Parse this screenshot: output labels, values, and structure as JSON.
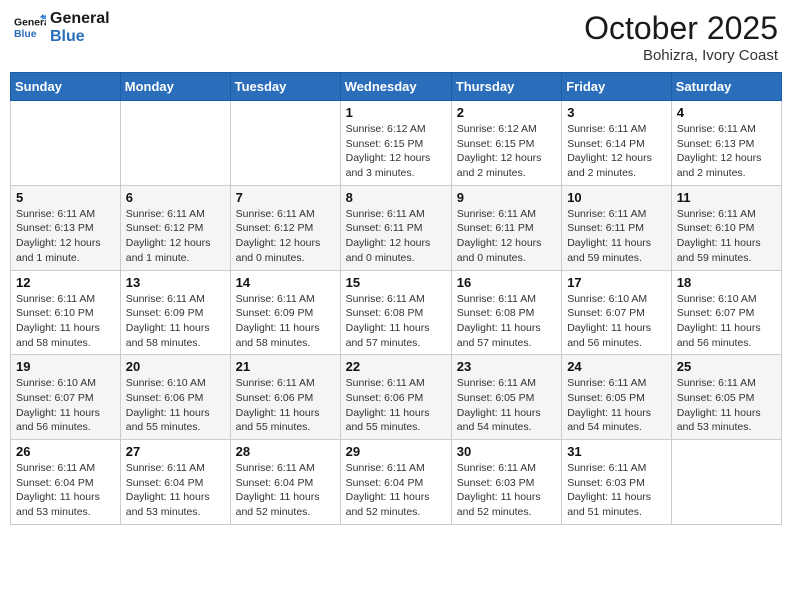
{
  "header": {
    "logo_line1": "General",
    "logo_line2": "Blue",
    "month": "October 2025",
    "location": "Bohizra, Ivory Coast"
  },
  "weekdays": [
    "Sunday",
    "Monday",
    "Tuesday",
    "Wednesday",
    "Thursday",
    "Friday",
    "Saturday"
  ],
  "weeks": [
    [
      {
        "day": "",
        "info": ""
      },
      {
        "day": "",
        "info": ""
      },
      {
        "day": "",
        "info": ""
      },
      {
        "day": "1",
        "info": "Sunrise: 6:12 AM\nSunset: 6:15 PM\nDaylight: 12 hours and 3 minutes."
      },
      {
        "day": "2",
        "info": "Sunrise: 6:12 AM\nSunset: 6:15 PM\nDaylight: 12 hours and 2 minutes."
      },
      {
        "day": "3",
        "info": "Sunrise: 6:11 AM\nSunset: 6:14 PM\nDaylight: 12 hours and 2 minutes."
      },
      {
        "day": "4",
        "info": "Sunrise: 6:11 AM\nSunset: 6:13 PM\nDaylight: 12 hours and 2 minutes."
      }
    ],
    [
      {
        "day": "5",
        "info": "Sunrise: 6:11 AM\nSunset: 6:13 PM\nDaylight: 12 hours and 1 minute."
      },
      {
        "day": "6",
        "info": "Sunrise: 6:11 AM\nSunset: 6:12 PM\nDaylight: 12 hours and 1 minute."
      },
      {
        "day": "7",
        "info": "Sunrise: 6:11 AM\nSunset: 6:12 PM\nDaylight: 12 hours and 0 minutes."
      },
      {
        "day": "8",
        "info": "Sunrise: 6:11 AM\nSunset: 6:11 PM\nDaylight: 12 hours and 0 minutes."
      },
      {
        "day": "9",
        "info": "Sunrise: 6:11 AM\nSunset: 6:11 PM\nDaylight: 12 hours and 0 minutes."
      },
      {
        "day": "10",
        "info": "Sunrise: 6:11 AM\nSunset: 6:11 PM\nDaylight: 11 hours and 59 minutes."
      },
      {
        "day": "11",
        "info": "Sunrise: 6:11 AM\nSunset: 6:10 PM\nDaylight: 11 hours and 59 minutes."
      }
    ],
    [
      {
        "day": "12",
        "info": "Sunrise: 6:11 AM\nSunset: 6:10 PM\nDaylight: 11 hours and 58 minutes."
      },
      {
        "day": "13",
        "info": "Sunrise: 6:11 AM\nSunset: 6:09 PM\nDaylight: 11 hours and 58 minutes."
      },
      {
        "day": "14",
        "info": "Sunrise: 6:11 AM\nSunset: 6:09 PM\nDaylight: 11 hours and 58 minutes."
      },
      {
        "day": "15",
        "info": "Sunrise: 6:11 AM\nSunset: 6:08 PM\nDaylight: 11 hours and 57 minutes."
      },
      {
        "day": "16",
        "info": "Sunrise: 6:11 AM\nSunset: 6:08 PM\nDaylight: 11 hours and 57 minutes."
      },
      {
        "day": "17",
        "info": "Sunrise: 6:10 AM\nSunset: 6:07 PM\nDaylight: 11 hours and 56 minutes."
      },
      {
        "day": "18",
        "info": "Sunrise: 6:10 AM\nSunset: 6:07 PM\nDaylight: 11 hours and 56 minutes."
      }
    ],
    [
      {
        "day": "19",
        "info": "Sunrise: 6:10 AM\nSunset: 6:07 PM\nDaylight: 11 hours and 56 minutes."
      },
      {
        "day": "20",
        "info": "Sunrise: 6:10 AM\nSunset: 6:06 PM\nDaylight: 11 hours and 55 minutes."
      },
      {
        "day": "21",
        "info": "Sunrise: 6:11 AM\nSunset: 6:06 PM\nDaylight: 11 hours and 55 minutes."
      },
      {
        "day": "22",
        "info": "Sunrise: 6:11 AM\nSunset: 6:06 PM\nDaylight: 11 hours and 55 minutes."
      },
      {
        "day": "23",
        "info": "Sunrise: 6:11 AM\nSunset: 6:05 PM\nDaylight: 11 hours and 54 minutes."
      },
      {
        "day": "24",
        "info": "Sunrise: 6:11 AM\nSunset: 6:05 PM\nDaylight: 11 hours and 54 minutes."
      },
      {
        "day": "25",
        "info": "Sunrise: 6:11 AM\nSunset: 6:05 PM\nDaylight: 11 hours and 53 minutes."
      }
    ],
    [
      {
        "day": "26",
        "info": "Sunrise: 6:11 AM\nSunset: 6:04 PM\nDaylight: 11 hours and 53 minutes."
      },
      {
        "day": "27",
        "info": "Sunrise: 6:11 AM\nSunset: 6:04 PM\nDaylight: 11 hours and 53 minutes."
      },
      {
        "day": "28",
        "info": "Sunrise: 6:11 AM\nSunset: 6:04 PM\nDaylight: 11 hours and 52 minutes."
      },
      {
        "day": "29",
        "info": "Sunrise: 6:11 AM\nSunset: 6:04 PM\nDaylight: 11 hours and 52 minutes."
      },
      {
        "day": "30",
        "info": "Sunrise: 6:11 AM\nSunset: 6:03 PM\nDaylight: 11 hours and 52 minutes."
      },
      {
        "day": "31",
        "info": "Sunrise: 6:11 AM\nSunset: 6:03 PM\nDaylight: 11 hours and 51 minutes."
      },
      {
        "day": "",
        "info": ""
      }
    ]
  ]
}
